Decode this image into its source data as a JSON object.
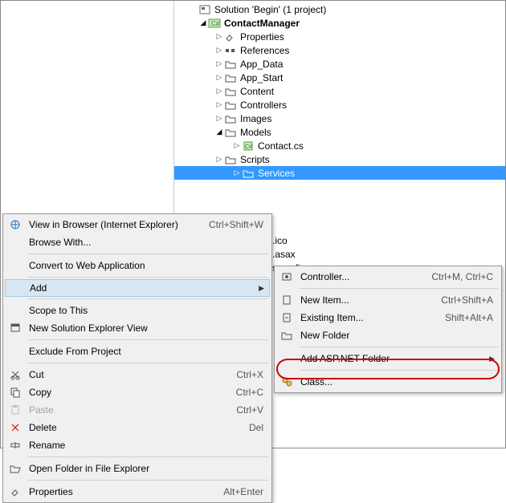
{
  "explorer": {
    "solution_line": "Solution 'Begin' (1 project)",
    "project": "ContactManager",
    "nodes": {
      "properties": "Properties",
      "references": "References",
      "app_data": "App_Data",
      "app_start": "App_Start",
      "content": "Content",
      "controllers": "Controllers",
      "images": "Images",
      "models": "Models",
      "contact_cs": "Contact.cs",
      "scripts": "Scripts",
      "services": "Services"
    },
    "peek": {
      "ico": ".ico",
      "asax": ".asax",
      "config": "s.config"
    }
  },
  "menu1": {
    "view_in_browser": "View in Browser (Internet Explorer)",
    "view_in_browser_sc": "Ctrl+Shift+W",
    "browse_with": "Browse With...",
    "convert_to_web": "Convert to Web Application",
    "add": "Add",
    "scope": "Scope to This",
    "new_sln_view": "New Solution Explorer View",
    "exclude": "Exclude From Project",
    "cut": "Cut",
    "cut_sc": "Ctrl+X",
    "copy": "Copy",
    "copy_sc": "Ctrl+C",
    "paste": "Paste",
    "paste_sc": "Ctrl+V",
    "delete": "Delete",
    "delete_sc": "Del",
    "rename": "Rename",
    "open_folder": "Open Folder in File Explorer",
    "properties": "Properties",
    "properties_sc": "Alt+Enter"
  },
  "menu2": {
    "controller": "Controller...",
    "controller_sc": "Ctrl+M, Ctrl+C",
    "new_item": "New Item...",
    "new_item_sc": "Ctrl+Shift+A",
    "existing_item": "Existing Item...",
    "existing_item_sc": "Shift+Alt+A",
    "new_folder": "New Folder",
    "add_aspnet": "Add ASP.NET Folder",
    "class": "Class..."
  }
}
